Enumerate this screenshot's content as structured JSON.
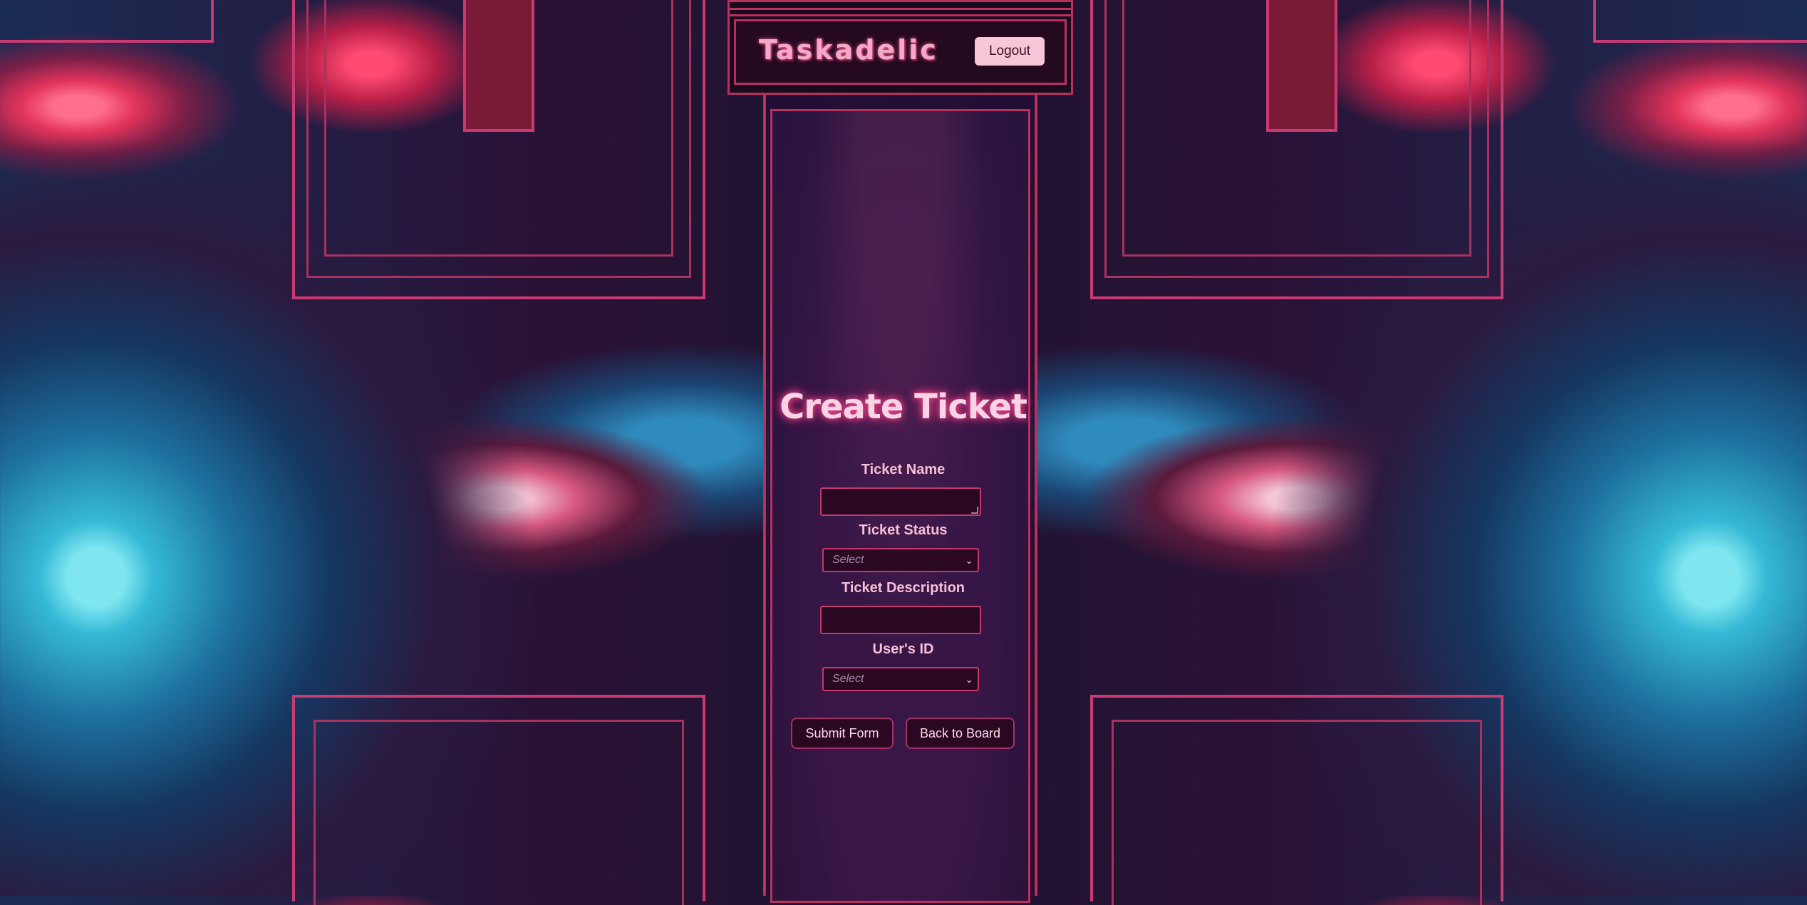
{
  "header": {
    "brand": "Taskadelic",
    "logout_label": "Logout"
  },
  "form": {
    "title": "Create Ticket",
    "ticket_name_label": "Ticket Name",
    "ticket_name_value": "",
    "ticket_status_label": "Ticket Status",
    "ticket_status_value": "Select",
    "ticket_description_label": "Ticket Description",
    "ticket_description_value": "",
    "user_id_label": "User's ID",
    "user_id_value": "Select",
    "submit_label": "Submit Form",
    "back_label": "Back to Board"
  },
  "colors": {
    "accent_pink": "#c73a72",
    "panel_dark": "#1a0a1e",
    "button_light": "#f7c6d7"
  }
}
